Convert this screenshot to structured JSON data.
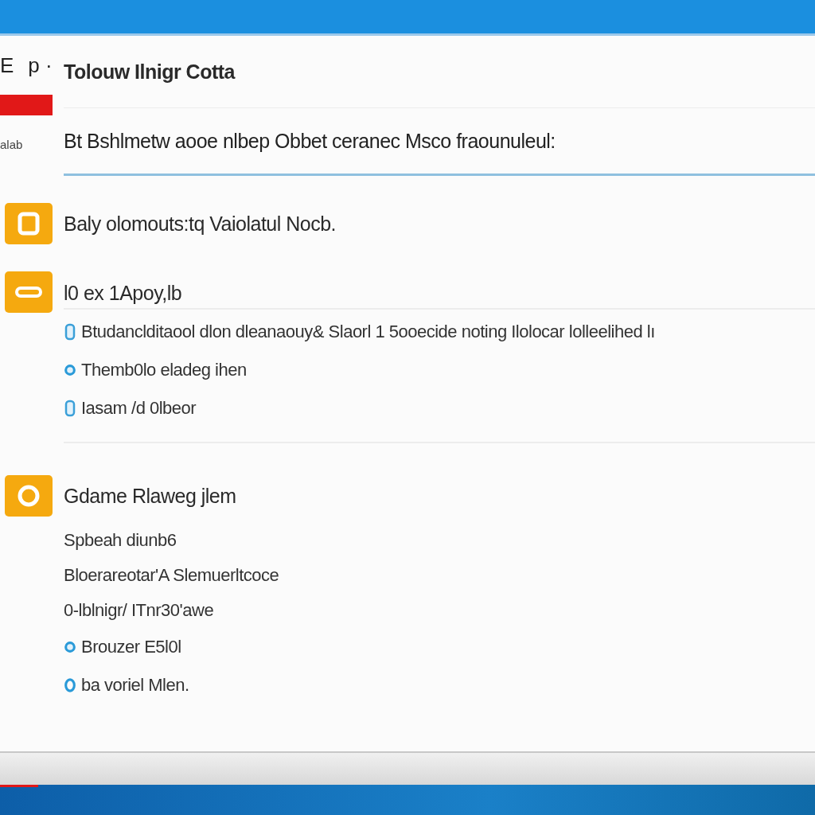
{
  "sidebar": {
    "items": [
      {
        "label": "E"
      },
      {
        "label": "p ·"
      }
    ],
    "caption": "alab"
  },
  "header": {
    "title": "Tolouw Ilnigr Cotta"
  },
  "banner": {
    "text": "Bt Bshlmetw aooe nlbep Obbet ceranec Msco fraounuleul:"
  },
  "sections": [
    {
      "kind": "square",
      "title": "Baly olomouts:tq Vaiolatul Nocb."
    },
    {
      "kind": "bar",
      "title": "l0 ex 1Apoy,lb",
      "lines": [
        {
          "kind": "info",
          "text": "Btudanclditaool dlon dleanaouy& Slaorl 1 5ooecide noting Ilolocar lolleelihed lı"
        },
        {
          "kind": "dot",
          "text": "Themb0lo eladeg ihen"
        },
        {
          "kind": "info",
          "text": "Iasam /d 0lbeor"
        }
      ]
    },
    {
      "kind": "ring",
      "title": "Gdame Rlaweg jlem",
      "lines": [
        {
          "kind": "plain",
          "text": "Spbeah diunb6"
        },
        {
          "kind": "plain",
          "text": "Bloerareotar'A Slemuerltcoce"
        },
        {
          "kind": "plain",
          "text": "0-lblnigr/ ITnr30'awe"
        },
        {
          "kind": "dot",
          "text": "Brouzer E5l0l"
        },
        {
          "kind": "ring",
          "text": "ba voriel Mlen."
        }
      ]
    }
  ]
}
